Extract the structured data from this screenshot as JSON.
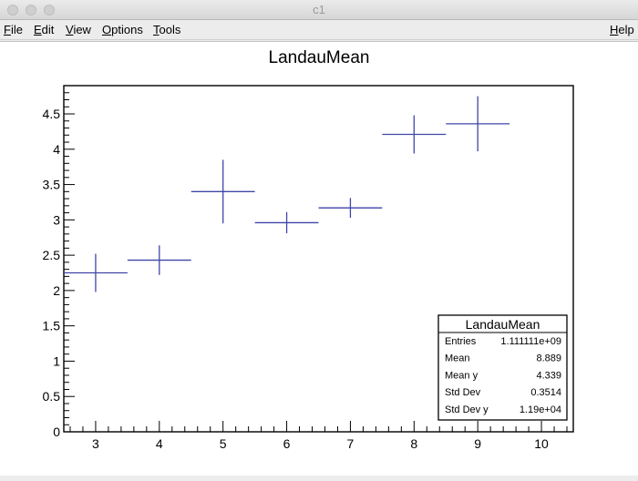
{
  "window": {
    "title": "c1"
  },
  "menu": {
    "file": {
      "mnemonic": "F",
      "rest": "ile"
    },
    "edit": {
      "mnemonic": "E",
      "rest": "dit"
    },
    "view": {
      "mnemonic": "V",
      "rest": "iew"
    },
    "options": {
      "mnemonic": "O",
      "rest": "ptions"
    },
    "tools": {
      "mnemonic": "T",
      "rest": "ools"
    },
    "help": {
      "mnemonic": "H",
      "rest": "elp"
    }
  },
  "colors": {
    "marker": "#3f46a8",
    "frame": "#000000"
  },
  "chart_data": {
    "type": "scatter",
    "title": "LandauMean",
    "xlim": [
      2.5,
      10.5
    ],
    "ylim": [
      0,
      4.9
    ],
    "xticks": [
      3,
      4,
      5,
      6,
      7,
      8,
      9,
      10
    ],
    "yticks": [
      0,
      0.5,
      1,
      1.5,
      2,
      2.5,
      3,
      3.5,
      4,
      4.5
    ],
    "ytick_labels": [
      "0",
      "0.5",
      "1",
      "1.5",
      "2",
      "2.5",
      "3",
      "3.5",
      "4",
      "4.5"
    ],
    "points": [
      {
        "x": 3,
        "y": 2.25,
        "xerr": 0.5,
        "yerr": 0.27
      },
      {
        "x": 4,
        "y": 2.43,
        "xerr": 0.5,
        "yerr": 0.21
      },
      {
        "x": 5,
        "y": 3.4,
        "xerr": 0.5,
        "yerr": 0.45
      },
      {
        "x": 6,
        "y": 2.96,
        "xerr": 0.5,
        "yerr": 0.15
      },
      {
        "x": 7,
        "y": 3.17,
        "xerr": 0.5,
        "yerr": 0.14
      },
      {
        "x": 8,
        "y": 4.21,
        "xerr": 0.5,
        "yerr": 0.27
      },
      {
        "x": 9,
        "y": 4.36,
        "xerr": 0.5,
        "yerr": 0.39
      }
    ],
    "stats": {
      "title": "LandauMean",
      "rows": [
        {
          "label": "Entries",
          "value": "1.111111e+09"
        },
        {
          "label": "Mean",
          "value": "8.889"
        },
        {
          "label": "Mean y",
          "value": "4.339"
        },
        {
          "label": "Std Dev",
          "value": "0.3514"
        },
        {
          "label": "Std Dev y",
          "value": "1.19e+04"
        }
      ]
    }
  }
}
